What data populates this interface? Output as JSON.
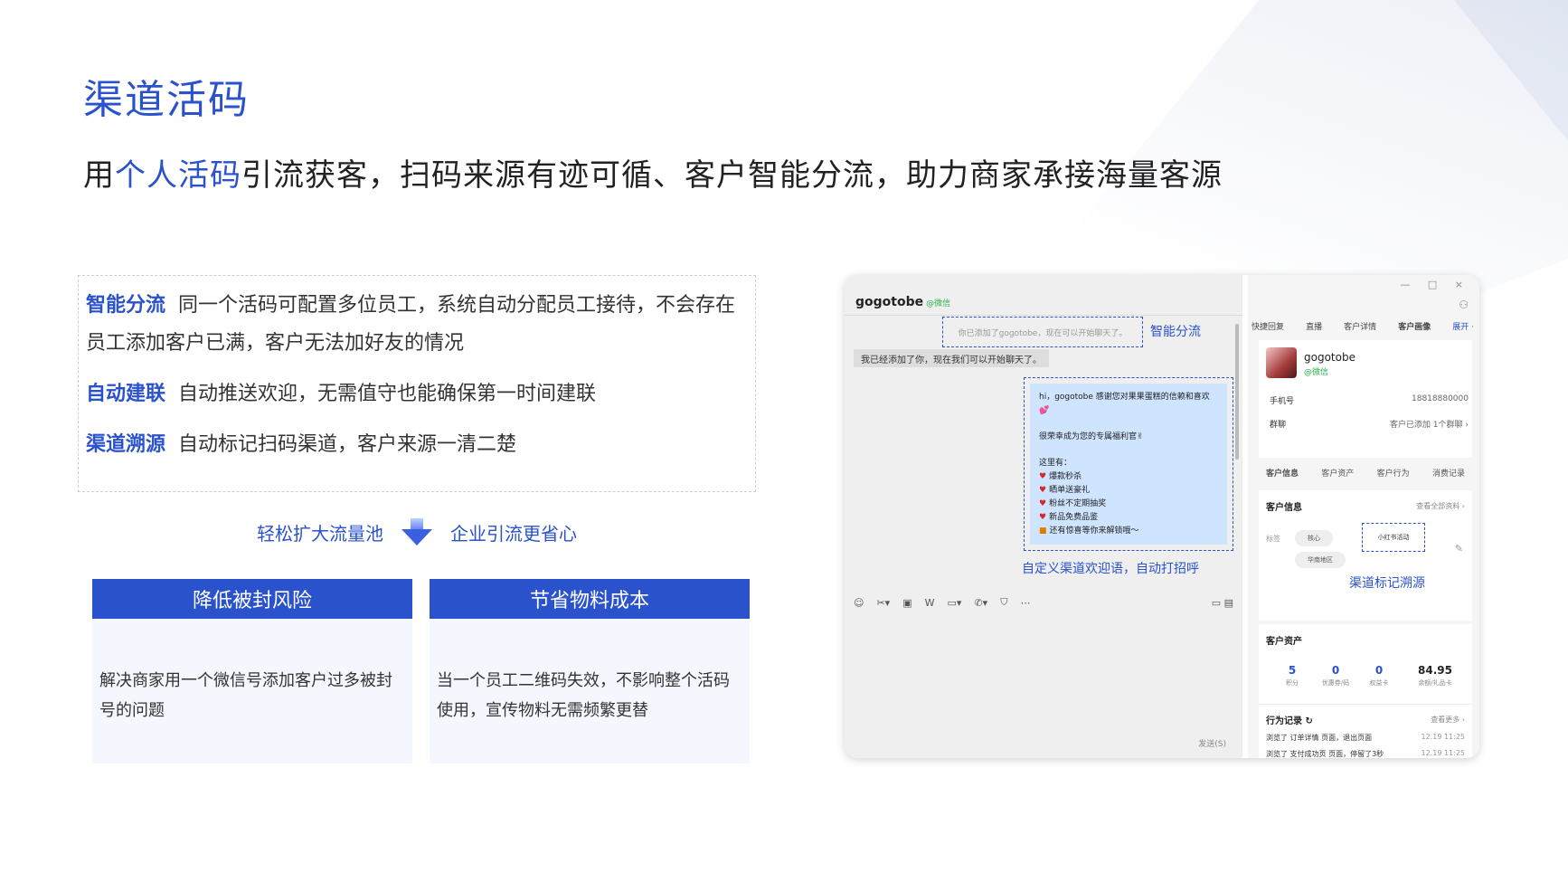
{
  "page": {
    "title": "渠道活码",
    "subtitle_pre": "用",
    "subtitle_highlight": "个人活码",
    "subtitle_post": "引流获客，扫码来源有迹可循、客户智能分流，助力商家承接海量客源"
  },
  "features": [
    {
      "key": "智能分流",
      "text": "同一个活码可配置多位员工，系统自动分配员工接待，不会存在员工添加客户已满，客户无法加好友的情况"
    },
    {
      "key": "自动建联",
      "text": "自动推送欢迎，无需值守也能确保第一时间建联"
    },
    {
      "key": "渠道溯源",
      "text": "自动标记扫码渠道，客户来源一清二楚"
    }
  ],
  "flow": {
    "left": "轻松扩大流量池",
    "right": "企业引流更省心"
  },
  "cards": [
    {
      "title": "降低被封风险",
      "body": "解决商家用一个微信号添加客户过多被封号的问题"
    },
    {
      "title": "节省物料成本",
      "body": "当一个员工二维码失效，不影响整个活码使用，宣传物料无需频繁更替"
    }
  ],
  "chat": {
    "contact": "gogotobe",
    "contact_source": "@微信",
    "window_controls": "— □ ×",
    "system_msg": "你已添加了gogotobe，现在可以开始聊天了。",
    "incoming": "我已经添加了你，现在我们可以开始聊天了。",
    "welcome_header": "hi，gogotobe 感谢您对果果蛋糕的信赖和喜欢💕",
    "welcome_line2": "很荣幸成为您的专属福利官✌",
    "welcome_list_title": "这里有：",
    "welcome_items": [
      "爆款秒杀",
      "晒单送豪礼",
      "粉丝不定期抽奖",
      "新品免费品鉴"
    ],
    "welcome_gift": "还有惊喜等你来解锁哦～",
    "send_label": "发送(S)",
    "toolbar_icons": [
      "☺",
      "✂▾",
      "▣",
      "W",
      "▭▾",
      "✆▾",
      "⛉",
      "⋯"
    ],
    "toolbar_right": "▭ ▤"
  },
  "annotations": {
    "smart_split": "智能分流",
    "custom_welcome": "自定义渠道欢迎语，自动打招呼",
    "channel_trace": "渠道标记溯源"
  },
  "side": {
    "user_icon": "⚇",
    "tabs": [
      "快捷回复",
      "直播",
      "客户详情",
      "客户画像",
      "展开 ·"
    ],
    "active_tab": 3,
    "profile_name": "gogotobe",
    "profile_source": "@微信",
    "phone_label": "手机号",
    "phone_value": "18818880000",
    "group_label": "群聊",
    "group_value": "客户已添加 1个群聊 ›",
    "tabs2": [
      "客户信息",
      "客户资产",
      "客户行为",
      "消费记录"
    ],
    "info_title": "客户信息",
    "info_more": "查看全部资料 ›",
    "tag_label": "标签",
    "tags": [
      "核心",
      "华南地区"
    ],
    "tag_channel": "小红书活动",
    "edit_icon": "✎",
    "asset_title": "客户资产",
    "stats": [
      {
        "n": "5",
        "l": "积分"
      },
      {
        "n": "0",
        "l": "优惠券/码"
      },
      {
        "n": "0",
        "l": "权益卡"
      },
      {
        "n": "84.95",
        "l": "余额/礼品卡"
      }
    ],
    "behavior_title": "行为记录 ↻",
    "behavior_more": "查看更多 ›",
    "records": [
      {
        "text": "浏览了 订单详情 页面，退出页面",
        "time": "12.19 11:25"
      },
      {
        "text": "浏览了 支付成功页 页面，停留了3秒",
        "time": "12.19 11:25"
      }
    ]
  }
}
